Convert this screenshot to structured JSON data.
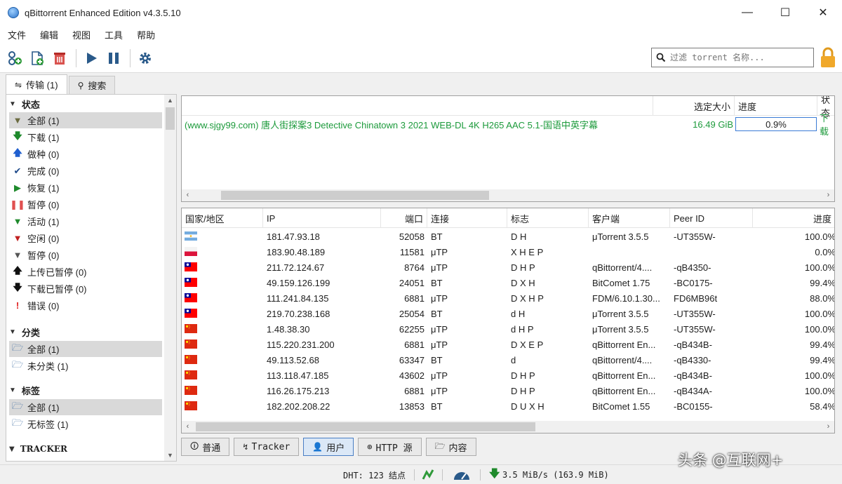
{
  "window": {
    "title": "qBittorrent Enhanced Edition v4.3.5.10",
    "minimize": "—",
    "maximize": "☐",
    "close": "✕"
  },
  "menu": [
    "文件",
    "编辑",
    "视图",
    "工具",
    "帮助"
  ],
  "search": {
    "placeholder": "过滤 torrent 名称..."
  },
  "tabs": [
    {
      "label": "传输 (1)"
    },
    {
      "label": "搜索"
    }
  ],
  "sidebar": {
    "status_header": "状态",
    "status_items": [
      {
        "label": "全部 (1)",
        "icon": "filter-icon",
        "color": "#6b6b40"
      },
      {
        "label": "下载 (1)",
        "icon": "download-arrow-icon",
        "color": "#1f8a2c"
      },
      {
        "label": "做种 (0)",
        "icon": "upload-arrow-icon",
        "color": "#1f5fcf"
      },
      {
        "label": "完成 (0)",
        "icon": "checkmark-icon",
        "color": "#1e4a8a"
      },
      {
        "label": "恢复 (1)",
        "icon": "play-icon",
        "color": "#1f8a2c"
      },
      {
        "label": "暂停 (0)",
        "icon": "pause-icon",
        "color": "#e05050"
      },
      {
        "label": "活动 (1)",
        "icon": "filter-green-icon",
        "color": "#1f8a2c"
      },
      {
        "label": "空闲 (0)",
        "icon": "filter-red-icon",
        "color": "#c02020"
      },
      {
        "label": "暂停 (0)",
        "icon": "filter-gray-icon",
        "color": "#555555"
      },
      {
        "label": "上传已暂停 (0)",
        "icon": "upload-black-icon",
        "color": "#111111"
      },
      {
        "label": "下载已暂停 (0)",
        "icon": "download-black-icon",
        "color": "#111111"
      },
      {
        "label": "错误 (0)",
        "icon": "error-icon",
        "color": "#e02020"
      }
    ],
    "category_header": "分类",
    "category_items": [
      {
        "label": "全部 (1)"
      },
      {
        "label": "未分类 (1)"
      }
    ],
    "tag_header": "标签",
    "tag_items": [
      {
        "label": "全部 (1)"
      },
      {
        "label": "无标签 (1)"
      }
    ],
    "tracker_header": "TRACKER"
  },
  "torrents": {
    "columns": [
      "选定大小",
      "进度",
      "状态"
    ],
    "rows": [
      {
        "name": "(www.sjgy99.com) 唐人街探案3 Detective Chinatown 3 2021 WEB-DL 4K H265 AAC 5.1-国语中英字幕",
        "size": "16.49 GiB",
        "progress": "0.9%",
        "status": "下载"
      }
    ]
  },
  "peers": {
    "columns": [
      "国家/地区",
      "IP",
      "端口",
      "连接",
      "标志",
      "客户端",
      "Peer ID",
      "进度"
    ],
    "rows": [
      {
        "flag": "argentina",
        "ip": "181.47.93.18",
        "port": "52058",
        "conn": "BT",
        "flags": "D H",
        "client": "μTorrent 3.5.5",
        "peer_id": "-UT355W-",
        "progress": "100.0%"
      },
      {
        "flag": "poland",
        "ip": "183.90.48.189",
        "port": "11581",
        "conn": "μTP",
        "flags": "X H E P",
        "client": "",
        "peer_id": "",
        "progress": "0.0%"
      },
      {
        "flag": "taiwan",
        "ip": "211.72.124.67",
        "port": "8764",
        "conn": "μTP",
        "flags": "D H P",
        "client": "qBittorrent/4....",
        "peer_id": "-qB4350-",
        "progress": "100.0%"
      },
      {
        "flag": "taiwan",
        "ip": "49.159.126.199",
        "port": "24051",
        "conn": "BT",
        "flags": "D X H",
        "client": "BitComet 1.75",
        "peer_id": "-BC0175-",
        "progress": "99.4%"
      },
      {
        "flag": "taiwan",
        "ip": "111.241.84.135",
        "port": "6881",
        "conn": "μTP",
        "flags": "D X H P",
        "client": "FDM/6.10.1.30...",
        "peer_id": "FD6MB96t",
        "progress": "88.0%"
      },
      {
        "flag": "taiwan",
        "ip": "219.70.238.168",
        "port": "25054",
        "conn": "BT",
        "flags": "d H",
        "client": "μTorrent 3.5.5",
        "peer_id": "-UT355W-",
        "progress": "100.0%"
      },
      {
        "flag": "china",
        "ip": "1.48.38.30",
        "port": "62255",
        "conn": "μTP",
        "flags": "d H P",
        "client": "μTorrent 3.5.5",
        "peer_id": "-UT355W-",
        "progress": "100.0%"
      },
      {
        "flag": "china",
        "ip": "115.220.231.200",
        "port": "6881",
        "conn": "μTP",
        "flags": "D X E P",
        "client": "qBittorrent En...",
        "peer_id": "-qB434B-",
        "progress": "99.4%"
      },
      {
        "flag": "china",
        "ip": "49.113.52.68",
        "port": "63347",
        "conn": "BT",
        "flags": "d",
        "client": "qBittorrent/4....",
        "peer_id": "-qB4330-",
        "progress": "99.4%"
      },
      {
        "flag": "china",
        "ip": "113.118.47.185",
        "port": "43602",
        "conn": "μTP",
        "flags": "D H P",
        "client": "qBittorrent En...",
        "peer_id": "-qB434B-",
        "progress": "100.0%"
      },
      {
        "flag": "china",
        "ip": "116.26.175.213",
        "port": "6881",
        "conn": "μTP",
        "flags": "D H P",
        "client": "qBittorrent En...",
        "peer_id": "-qB434A-",
        "progress": "100.0%"
      },
      {
        "flag": "china",
        "ip": "182.202.208.22",
        "port": "13853",
        "conn": "BT",
        "flags": "D U X H",
        "client": "BitComet 1.55",
        "peer_id": "-BC0155-",
        "progress": "58.4%"
      }
    ]
  },
  "bottom_tabs": [
    {
      "label": "普通",
      "icon": "info-icon"
    },
    {
      "label": "Tracker",
      "icon": "tracker-icon"
    },
    {
      "label": "用户",
      "icon": "users-icon"
    },
    {
      "label": "HTTP 源",
      "icon": "http-icon"
    },
    {
      "label": "内容",
      "icon": "folder-icon"
    }
  ],
  "status": {
    "dht": "DHT: 123 结点",
    "speed": "3.5 MiB/s (163.9 MiB)"
  },
  "watermark": "头条 @互联网+",
  "colors": {
    "accent": "#3a7bd5",
    "downloading": "#1c9a3b"
  }
}
